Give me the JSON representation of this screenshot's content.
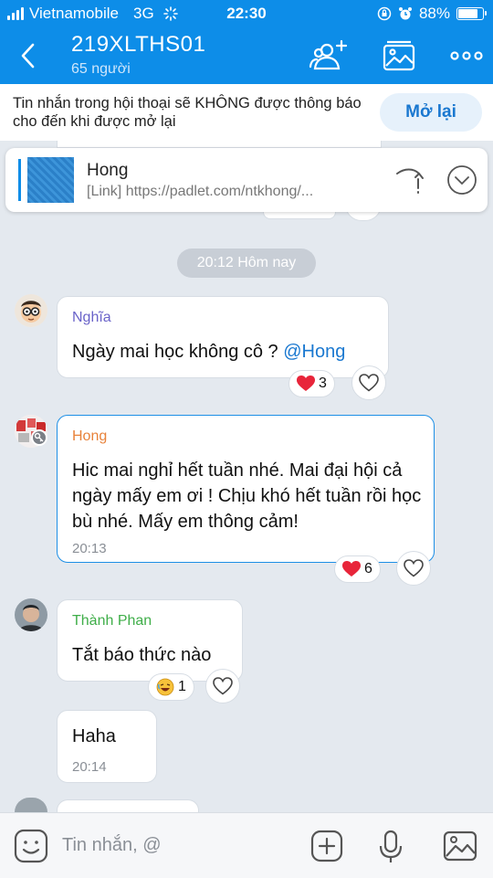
{
  "status_bar": {
    "carrier": "Vietnamobile",
    "network": "3G",
    "time": "22:30",
    "battery": "88%",
    "battery_level": 0.88
  },
  "header": {
    "title": "219XLTHS01",
    "subtitle": "65 người"
  },
  "mute_banner": {
    "text": "Tin nhắn trong hội thoại sẽ KHÔNG được thông báo cho đến khi được mở lại",
    "button": "Mở lại"
  },
  "pinned": {
    "name": "Hong",
    "preview": "[Link] https://padlet.com/ntkhong/..."
  },
  "time_divider": "20:12 Hôm nay",
  "messages": [
    {
      "sender": "Nghĩa",
      "sender_color": "#6a63c9",
      "text": "Ngày mai học không cô ? ",
      "mention": "@Hong",
      "reaction_count": "3"
    },
    {
      "sender": "Hong",
      "sender_color": "#e8823a",
      "text": "Hic mai nghỉ hết tuần nhé. Mai đại hội cả ngày mấy em ơi ! Chịu khó hết tuần rồi học bù nhé. Mấy em thông cảm!",
      "time": "20:13",
      "reaction_count": "6"
    },
    {
      "sender": "Thành Phan",
      "sender_color": "#3fae49",
      "text": "Tắt báo thức nào",
      "reaction_count": "1"
    },
    {
      "text": "Haha",
      "time": "20:14"
    }
  ],
  "input": {
    "placeholder": "Tin nhắn, @"
  },
  "colors": {
    "primary": "#0d8de8",
    "mention": "#1a78d0",
    "heart": "#e8253a",
    "selected_border": "#1d8fe6"
  }
}
